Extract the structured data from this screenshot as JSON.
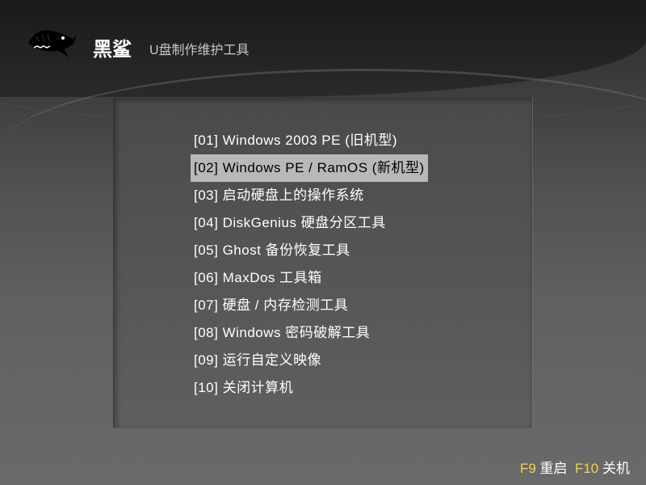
{
  "header": {
    "brand_name": "黑鲨",
    "subtitle": "U盘制作维护工具"
  },
  "menu": {
    "selected_index": 1,
    "items": [
      {
        "label": "[01] Windows 2003 PE (旧机型)"
      },
      {
        "label": "[02] Windows PE / RamOS (新机型)"
      },
      {
        "label": "[03] 启动硬盘上的操作系统"
      },
      {
        "label": "[04] DiskGenius 硬盘分区工具"
      },
      {
        "label": "[05] Ghost 备份恢复工具"
      },
      {
        "label": "[06] MaxDos 工具箱"
      },
      {
        "label": "[07] 硬盘 / 内存检测工具"
      },
      {
        "label": "[08] Windows 密码破解工具"
      },
      {
        "label": "[09] 运行自定义映像"
      },
      {
        "label": "[10] 关闭计算机"
      }
    ]
  },
  "footer": {
    "f9": "F9",
    "f9_label": "重启",
    "f10": "F10",
    "f10_label": "关机"
  }
}
